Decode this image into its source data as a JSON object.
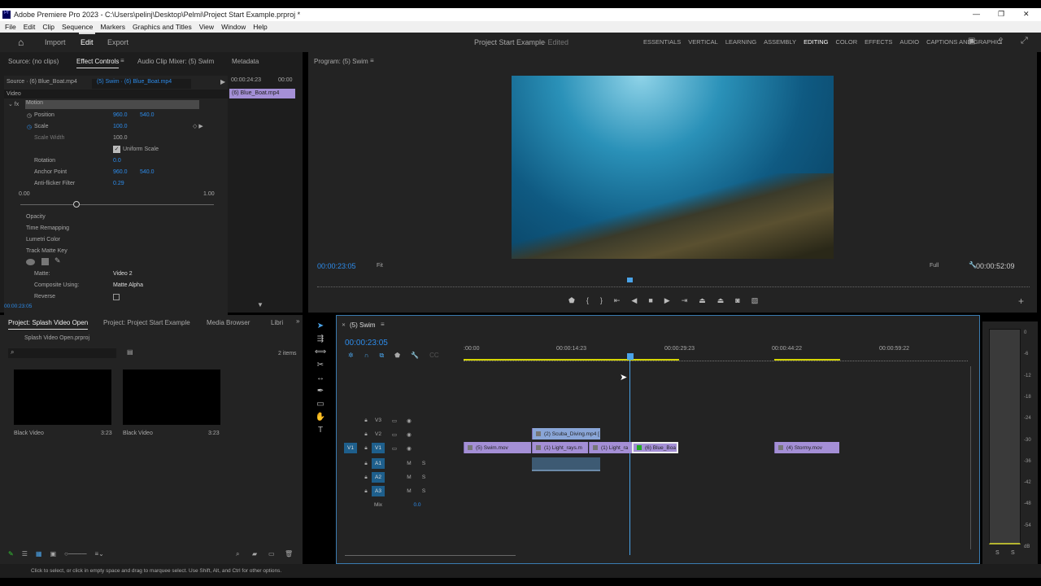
{
  "window": {
    "title": "Adobe Premiere Pro 2023 - C:\\Users\\pelinj\\Desktop\\Pelmi\\Project Start Example.prproj *",
    "min": "—",
    "max": "❐",
    "close": "✕"
  },
  "menu": [
    "File",
    "Edit",
    "Clip",
    "Sequence",
    "Markers",
    "Graphics and Titles",
    "View",
    "Window",
    "Help"
  ],
  "header": {
    "tabs": [
      "Import",
      "Edit",
      "Export"
    ],
    "project": "Project Start Example",
    "status": "- Edited",
    "workspaces": [
      "ESSENTIALS",
      "VERTICAL",
      "LEARNING",
      "ASSEMBLY",
      "EDITING",
      "COLOR",
      "EFFECTS",
      "AUDIO",
      "CAPTIONS AND GRAPHIC"
    ]
  },
  "effect_panel": {
    "tabs": [
      "Source: (no clips)",
      "Effect Controls",
      "Audio Clip Mixer: (5) Swim",
      "Metadata"
    ],
    "source": "Source · (6) Blue_Boat.mp4",
    "sequence": "(5) Swim · (6) Blue_Boat.mp4",
    "mini_time": "00:00:24:23",
    "mini_time2": "00:00",
    "mini_clip": "(6) Blue_Boat.mp4",
    "section": "Video",
    "motion": "Motion",
    "position_label": "Position",
    "pos_x": "960.0",
    "pos_y": "540.0",
    "scale_label": "Scale",
    "scale": "100.0",
    "scale_width_label": "Scale Width",
    "scale_width": "100.0",
    "uniform": "Uniform Scale",
    "rotation_label": "Rotation",
    "rotation": "0.0",
    "anchor_label": "Anchor Point",
    "anc_x": "960.0",
    "anc_y": "540.0",
    "anti_label": "Anti-flicker Filter",
    "anti": "0.29",
    "slider_min": "0.00",
    "slider_max": "1.00",
    "slider_value": 0.29,
    "opacity": "Opacity",
    "time_remap": "Time Remapping",
    "lumetri": "Lumetri Color",
    "track_matte": "Track Matte Key",
    "matte_label": "Matte:",
    "matte": "Video 2",
    "composite_label": "Composite Using:",
    "composite": "Matte Alpha",
    "reverse": "Reverse",
    "timecode": "00:00:23:05"
  },
  "program": {
    "title": "Program: (5) Swim",
    "timecode": "00:00:23:05",
    "fit": "Fit",
    "quality": "Full",
    "duration": "00:00:52:09"
  },
  "project": {
    "tabs": [
      "Project: Splash Video Open",
      "Project: Project Start Example",
      "Media Browser",
      "Libri"
    ],
    "file": "Splash Video Open.prproj",
    "count": "2 items",
    "items": [
      {
        "name": "Black Video",
        "dur": "3:23"
      },
      {
        "name": "Black Video",
        "dur": "3:23"
      }
    ]
  },
  "timeline": {
    "title": "(5) Swim",
    "timecode": "00:00:23:05",
    "ruler": [
      ":00:00",
      "00:00:14:23",
      "00:00:29:23",
      "00:00:44:22",
      "00:00:59:22"
    ],
    "video_tracks": [
      "V3",
      "V2",
      "V1"
    ],
    "audio_tracks": [
      "A1",
      "A2",
      "A3"
    ],
    "source_patch": "V1",
    "mix": "Mix",
    "mix_val": "0.0",
    "m": "M",
    "s": "S",
    "clips": {
      "scuba": "(2) Scuba_Diving.mp4 [",
      "swim": "(5) Swim.mov",
      "light1": "(1) Light_rays.m",
      "light2": "(1) Light_ra",
      "boat": "(6) Blue_Boa",
      "stormy": "(4) Stormy.mov"
    }
  },
  "meter": {
    "scale": [
      "0",
      "-6",
      "-12",
      "-18",
      "-24",
      "-30",
      "-36",
      "-42",
      "-48",
      "-54",
      "dB"
    ],
    "solo": [
      "S",
      "S"
    ]
  },
  "status": "Click to select, or click in empty space and drag to marquee select. Use Shift, Alt, and Ctrl for other options."
}
